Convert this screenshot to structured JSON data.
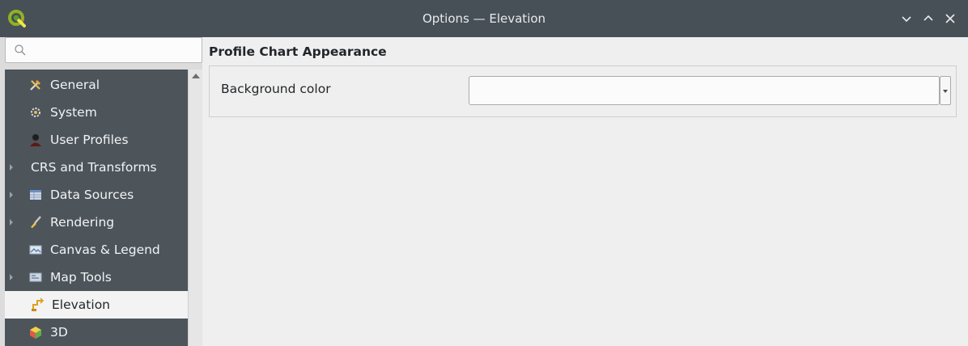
{
  "window": {
    "title": "Options — Elevation",
    "app_icon": "qgis-logo-icon",
    "controls": [
      "minimize-icon",
      "maximize-icon",
      "close-icon"
    ]
  },
  "sidebar": {
    "search_placeholder": "",
    "items": [
      {
        "label": "General",
        "icon": "tools-icon",
        "expandable": false,
        "selected": false
      },
      {
        "label": "System",
        "icon": "system-icon",
        "expandable": false,
        "selected": false
      },
      {
        "label": "User Profiles",
        "icon": "user-icon",
        "expandable": false,
        "selected": false
      },
      {
        "label": "CRS and Transforms",
        "icon": "",
        "expandable": true,
        "selected": false
      },
      {
        "label": "Data Sources",
        "icon": "table-icon",
        "expandable": true,
        "selected": false
      },
      {
        "label": "Rendering",
        "icon": "paintbrush-icon",
        "expandable": true,
        "selected": false
      },
      {
        "label": "Canvas & Legend",
        "icon": "map-canvas-icon",
        "expandable": false,
        "selected": false
      },
      {
        "label": "Map Tools",
        "icon": "map-tools-icon",
        "expandable": true,
        "selected": false
      },
      {
        "label": "Elevation",
        "icon": "elevation-icon",
        "expandable": false,
        "selected": true
      },
      {
        "label": "3D",
        "icon": "cube-3d-icon",
        "expandable": false,
        "selected": false
      }
    ]
  },
  "main": {
    "section_title": "Profile Chart Appearance",
    "background_color_label": "Background color",
    "background_color_value": ""
  },
  "colors": {
    "titlebar": "#475057",
    "sidebar_bg": "#4d555b",
    "selected_bg": "#f3f3f3",
    "window_bg": "#efefef"
  }
}
